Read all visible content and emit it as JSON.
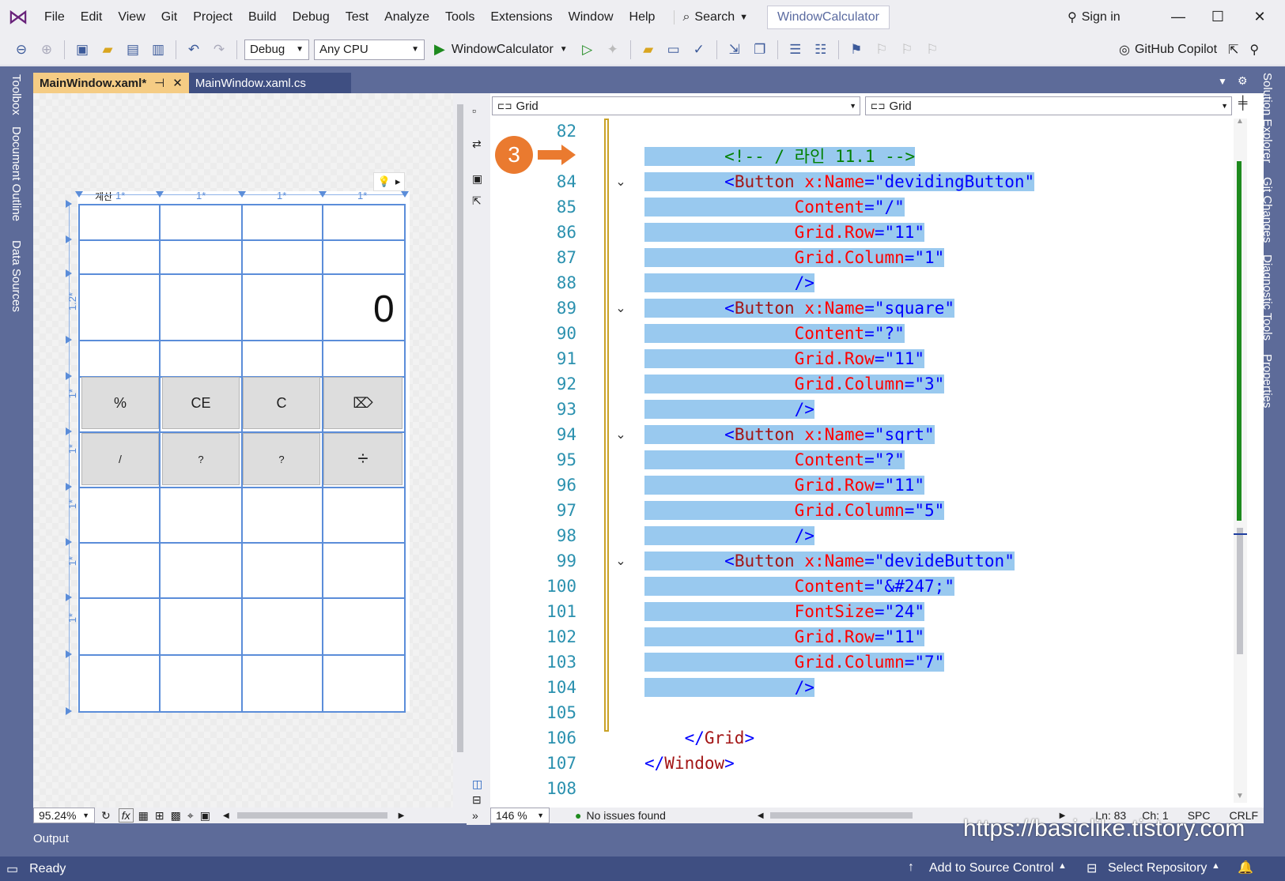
{
  "menu": [
    "File",
    "Edit",
    "View",
    "Git",
    "Project",
    "Build",
    "Debug",
    "Test",
    "Analyze",
    "Tools",
    "Extensions",
    "Window",
    "Help"
  ],
  "search_label": "Search",
  "solution_name": "WindowCalculator",
  "sign_in": "Sign in",
  "toolbar": {
    "config": "Debug",
    "platform": "Any CPU",
    "run_target": "WindowCalculator",
    "copilot": "GitHub Copilot"
  },
  "left_tool_tabs": [
    "Toolbox",
    "Document Outline",
    "Data Sources"
  ],
  "right_tool_tabs": [
    "Solution Explorer",
    "Git Changes",
    "Diagnostic Tools",
    "Properties"
  ],
  "tabs": [
    {
      "label": "MainWindow.xaml*",
      "active": true
    },
    {
      "label": "MainWindow.xaml.cs",
      "active": false
    }
  ],
  "designer": {
    "title_fragment": "계산",
    "col_labels": [
      "1*",
      "1*",
      "1*",
      "1*"
    ],
    "row_labels": [
      "1.2*",
      "1*",
      "1*",
      "1*",
      "1*",
      "1*"
    ],
    "display_value": "0",
    "buttons_row1": [
      "%",
      "CE",
      "C",
      "⌦"
    ],
    "buttons_row2": [
      "/",
      "?",
      "?",
      "÷"
    ],
    "zoom": "95.24%"
  },
  "editor": {
    "nav_left": "Grid",
    "nav_right": "Grid",
    "zoom": "146 %",
    "issues": "No issues found",
    "ln": "Ln: 83",
    "ch": "Ch: 1",
    "spc": "SPC",
    "crlf": "CRLF",
    "line_numbers": [
      "82",
      "83",
      "84",
      "85",
      "86",
      "87",
      "88",
      "89",
      "90",
      "91",
      "92",
      "93",
      "94",
      "95",
      "96",
      "97",
      "98",
      "99",
      "100",
      "101",
      "102",
      "103",
      "104",
      "105",
      "106",
      "107",
      "108"
    ],
    "code": {
      "l83_comment": "<!-- / 라인 11.1 -->",
      "b1": {
        "tag": "Button",
        "name_attr": "x:Name",
        "name": "\"devidingButton\"",
        "content": "\"/\"",
        "row": "\"11\"",
        "col": "\"1\""
      },
      "b2": {
        "tag": "Button",
        "name_attr": "x:Name",
        "name": "\"square\"",
        "content": "\"?\"",
        "row": "\"11\"",
        "col": "\"3\""
      },
      "b3": {
        "tag": "Button",
        "name_attr": "x:Name",
        "name": "\"sqrt\"",
        "content": "\"?\"",
        "row": "\"11\"",
        "col": "\"5\""
      },
      "b4": {
        "tag": "Button",
        "name_attr": "x:Name",
        "name": "\"devideButton\"",
        "content": "\"&#247;\"",
        "fontsize": "\"24\"",
        "row": "\"11\"",
        "col": "\"7\""
      },
      "attr_content": "Content",
      "attr_row": "Grid.Row",
      "attr_col": "Grid.Column",
      "attr_fontsize": "FontSize",
      "close_grid": "Grid",
      "close_window": "Window"
    }
  },
  "step_badge": "3",
  "output_label": "Output",
  "status": {
    "ready": "Ready",
    "source_control": "Add to Source Control",
    "repo": "Select Repository"
  },
  "watermark": "https://basiclike.tistory.com"
}
